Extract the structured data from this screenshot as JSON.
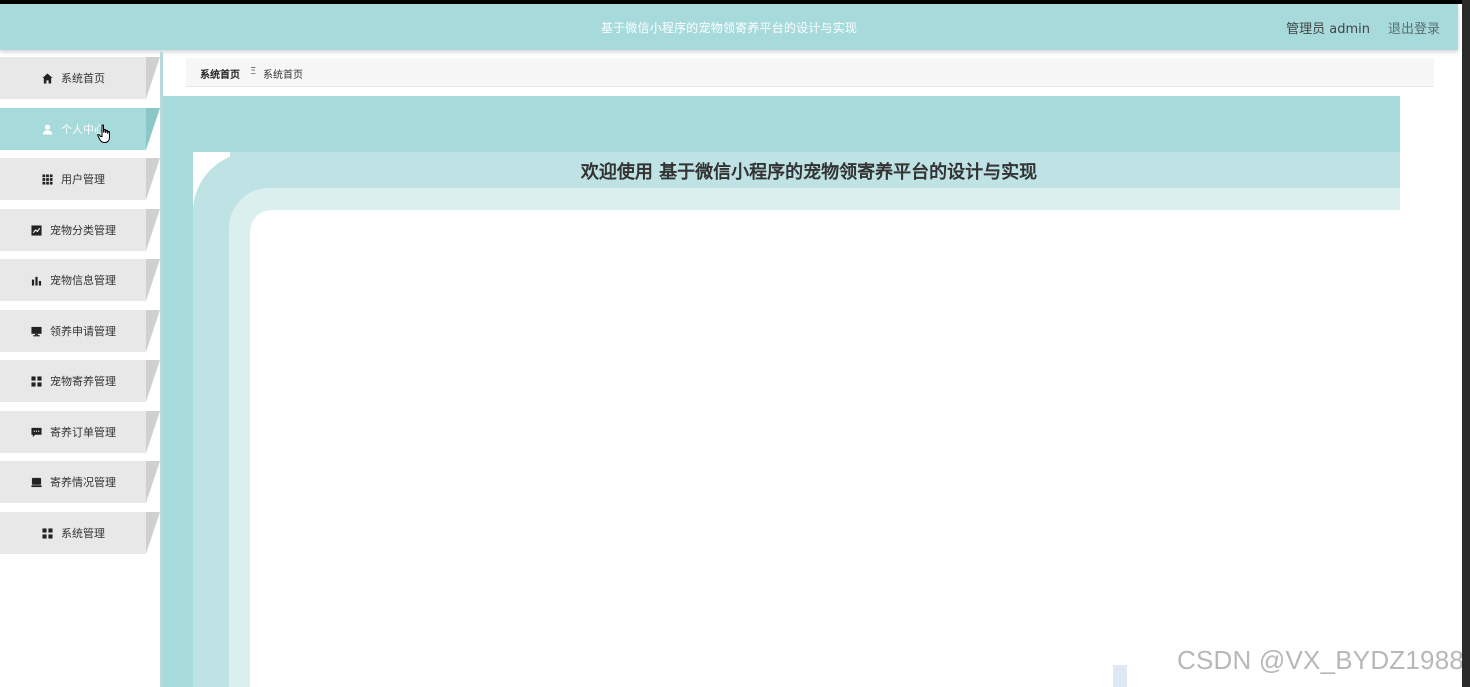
{
  "header": {
    "title": "基于微信小程序的宠物领寄养平台的设计与实现",
    "user_label": "管理员 admin",
    "logout_label": "退出登录"
  },
  "sidebar": {
    "items": [
      {
        "label": "系统首页",
        "icon": "home-icon",
        "active": false
      },
      {
        "label": "个人中心",
        "icon": "user-icon",
        "active": true
      },
      {
        "label": "用户管理",
        "icon": "grid-icon",
        "active": false
      },
      {
        "label": "宠物分类管理",
        "icon": "chart-line-icon",
        "active": false
      },
      {
        "label": "宠物信息管理",
        "icon": "bar-chart-icon",
        "active": false
      },
      {
        "label": "领养申请管理",
        "icon": "monitor-icon",
        "active": false
      },
      {
        "label": "宠物寄养管理",
        "icon": "apps-icon",
        "active": false
      },
      {
        "label": "寄养订单管理",
        "icon": "chat-icon",
        "active": false
      },
      {
        "label": "寄养情况管理",
        "icon": "box-icon",
        "active": false
      },
      {
        "label": "系统管理",
        "icon": "apps-icon",
        "active": false
      }
    ]
  },
  "breadcrumb": {
    "first": "系统首页",
    "separator": "Ξ",
    "second": "系统首页"
  },
  "main": {
    "welcome": "欢迎使用 基于微信小程序的宠物领寄养平台的设计与实现"
  },
  "watermark": "CSDN @VX_BYDZ1988",
  "colors": {
    "accent": "#a6dadb",
    "band": "#bfe3e4",
    "band_light": "#dcefef",
    "nav_bg": "#e8e8e8"
  }
}
